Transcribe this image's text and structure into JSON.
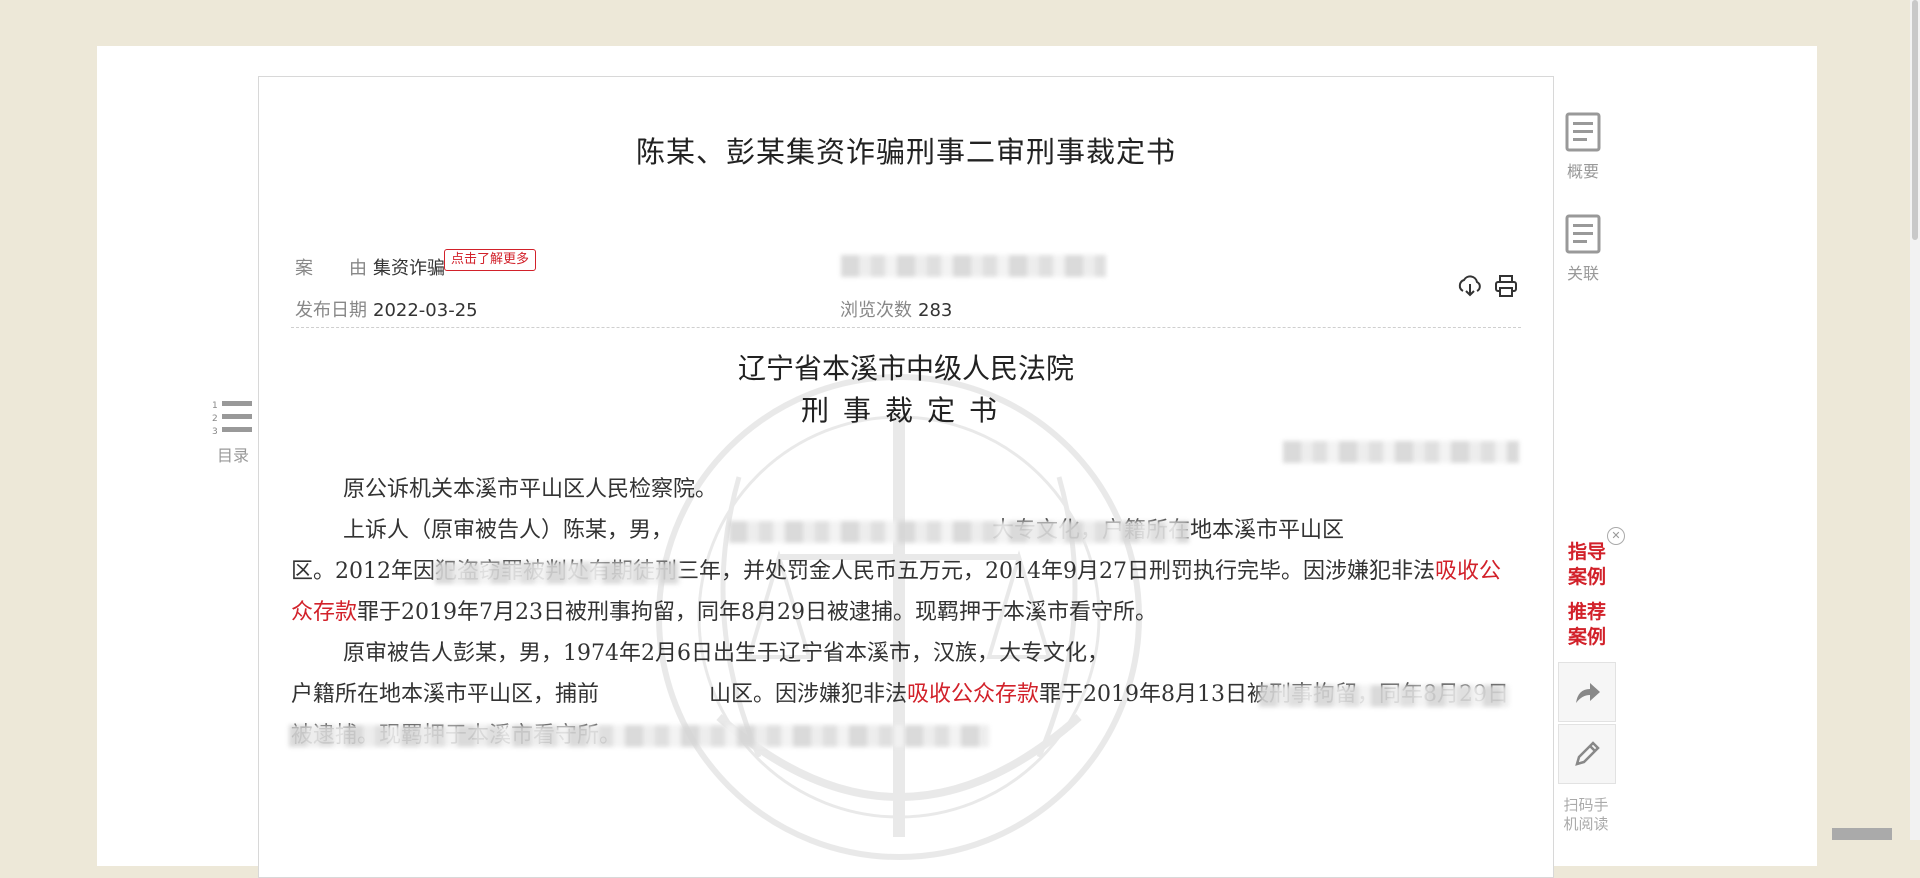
{
  "document": {
    "title": "陈某、彭某集资诈骗刑事二审刑事裁定书",
    "cause_label": "案　　由",
    "cause_value": "集资诈骗",
    "learn_more": "点击了解更多",
    "publish_label": "发布日期",
    "publish_value": "2022-03-25",
    "views_label": "浏览次数",
    "views_value": "283",
    "court": "辽宁省本溪市中级人民法院",
    "doc_type": "刑事裁定书",
    "paragraphs": [
      {
        "a": "原公诉机关本溪市平山区人民检察院。",
        "hl": "",
        "b": ""
      },
      {
        "a": "上诉人（原审被告人）陈某，男，　　　　　　　　　　　　　　　大专文化，户籍所在地本溪市平山区　　　　　　　　区。2012年因犯盗窃罪被判处有期徒刑三年，并处罚金人民币五万元，2014年9月27日刑罚执行完毕。因涉嫌犯非法",
        "hl": "吸收公众存款",
        "b": "罪于2019年7月23日被刑事拘留，同年8月29日被逮捕。现羁押于本溪市看守所。"
      },
      {
        "a": "原审被告人彭某，男，1974年2月6日出生于辽宁省本溪市，汉族，大专文化，　　　　　　　　　　　　　　　　　　　　　　　　　　　　户籍所在地本溪市平山区，捕前　　　　　山区。因涉嫌犯非法",
        "hl": "吸收公众存款",
        "b": "罪于2019年8月13日被刑事拘留，同年8月29日被逮捕。现羁押于本溪市看守所。"
      }
    ]
  },
  "sidebar": {
    "summary_label": "概要",
    "related_label": "关联",
    "toc_label": "目录",
    "guide_label": "指导案例",
    "recommend_label": "推荐案例",
    "qr_label": "扫码手机阅读"
  },
  "colors": {
    "accent": "#d2212a",
    "page_bg": "#ede8d8"
  }
}
